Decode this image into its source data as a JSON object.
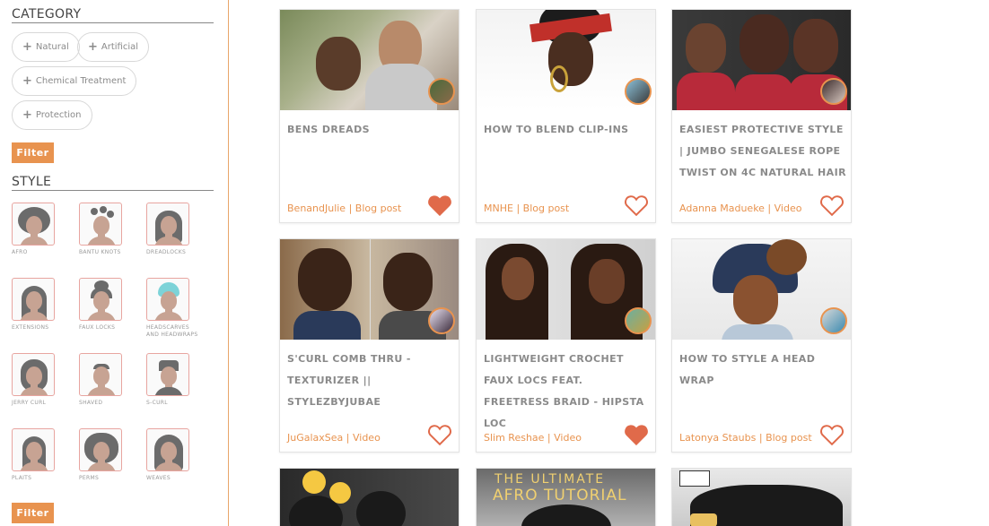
{
  "sidebar": {
    "category_title": "CATEGORY",
    "categories": [
      {
        "label": "Natural"
      },
      {
        "label": "Artificial"
      },
      {
        "label": "Chemical Treatment"
      },
      {
        "label": "Protection"
      }
    ],
    "filter_label": "Filter",
    "style_title": "STYLE",
    "styles": [
      {
        "label": "AFRO"
      },
      {
        "label": "BANTU KNOTS"
      },
      {
        "label": "DREADLOCKS"
      },
      {
        "label": "EXTENSIONS"
      },
      {
        "label": "FAUX LOCKS"
      },
      {
        "label": "HEADSCARVES AND HEADWRAPS"
      },
      {
        "label": "JERRY CURL"
      },
      {
        "label": "SHAVED"
      },
      {
        "label": "S-CURL"
      },
      {
        "label": "PLAITS"
      },
      {
        "label": "PERMS"
      },
      {
        "label": "WEAVES"
      }
    ],
    "filter_label_2": "Filter"
  },
  "cards": [
    {
      "title": "BENS DREADS",
      "author": "BenandJulie",
      "type": "Blog post",
      "liked": true
    },
    {
      "title": "HOW TO BLEND CLIP-INS",
      "author": "MNHE",
      "type": "Blog post",
      "liked": false
    },
    {
      "title": "EASIEST PROTECTIVE STYLE | JUMBO SENEGALESE ROPE TWIST ON 4C NATURAL HAIR",
      "author": "Adanna Madueke",
      "type": "Video",
      "liked": false
    },
    {
      "title": "S'CURL COMB THRU - TEXTURIZER || STYLEZBYJUBAE",
      "author": "JuGalaxSea",
      "type": "Video",
      "liked": false
    },
    {
      "title": "LIGHTWEIGHT CROCHET FAUX LOCS FEAT. FREETRESS BRAID - HIPSTA LOC",
      "author": "Slim Reshae",
      "type": "Video",
      "liked": true
    },
    {
      "title": "HOW TO STYLE A HEAD WRAP",
      "author": "Latonya Staubs",
      "type": "Blog post",
      "liked": false
    }
  ],
  "partial_cards": [
    {
      "overlay_line1": "",
      "overlay_line2": ""
    },
    {
      "overlay_line1": "THE ULTIMATE",
      "overlay_line2": "AFRO TUTORIAL"
    },
    {
      "overlay_line1": "",
      "overlay_line2": ""
    }
  ],
  "colors": {
    "accent": "#e8934f",
    "heart": "#e06a4a",
    "text_muted": "#8a8a8a"
  }
}
